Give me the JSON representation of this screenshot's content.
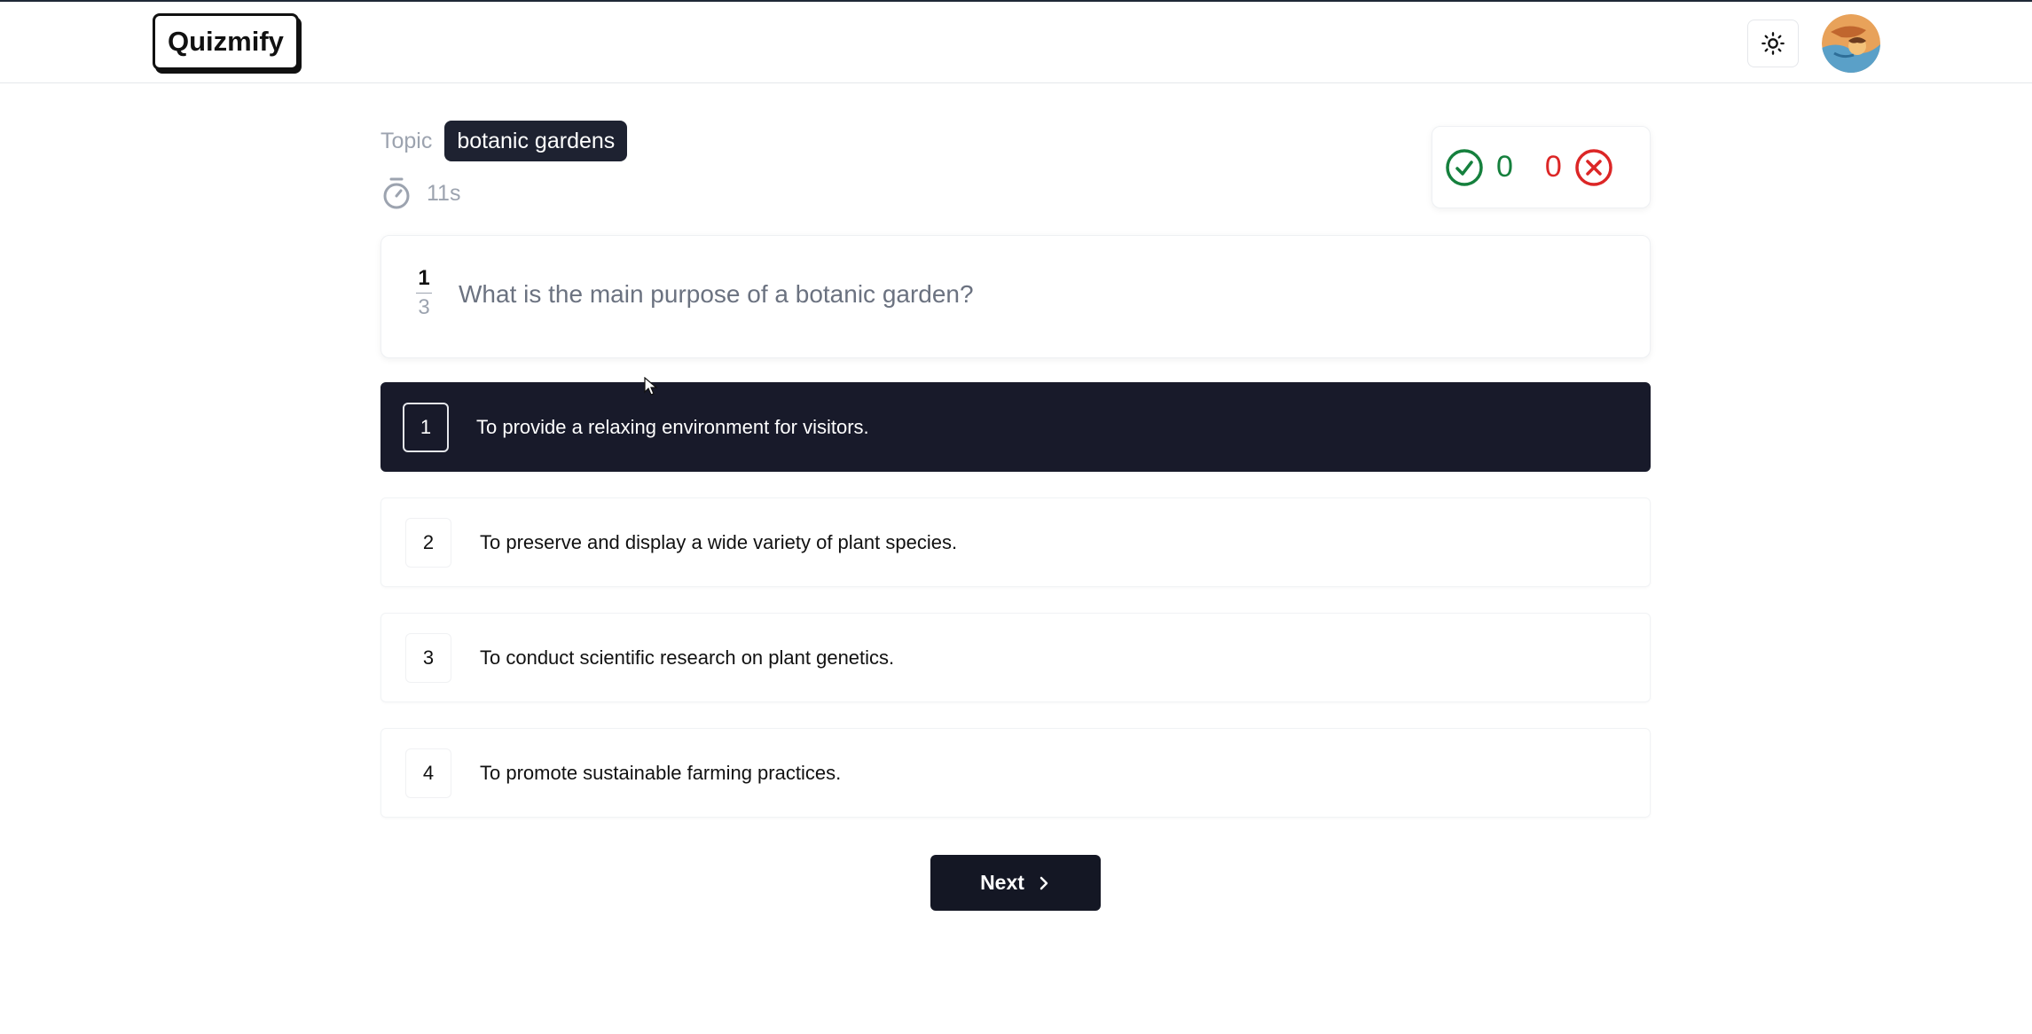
{
  "app": {
    "logo_text": "Quizmify"
  },
  "header": {
    "theme_toggle_icon": "sun-icon",
    "avatar_icon": "user-avatar"
  },
  "quiz": {
    "topic_label": "Topic",
    "topic_value": "botanic gardens",
    "timer": "11s",
    "score": {
      "correct": "0",
      "wrong": "0",
      "correct_color": "#15803d",
      "wrong_color": "#dc2626"
    },
    "question": {
      "current": "1",
      "total": "3",
      "text": "What is the main purpose of a botanic garden?"
    },
    "options": [
      {
        "number": "1",
        "text": "To provide a relaxing environment for visitors.",
        "selected": true
      },
      {
        "number": "2",
        "text": "To preserve and display a wide variety of plant species.",
        "selected": false
      },
      {
        "number": "3",
        "text": "To conduct scientific research on plant genetics.",
        "selected": false
      },
      {
        "number": "4",
        "text": "To promote sustainable farming practices.",
        "selected": false
      }
    ],
    "next_label": "Next"
  },
  "colors": {
    "selected_option_bg": "#181a2a",
    "badge_bg": "#1e2231"
  }
}
